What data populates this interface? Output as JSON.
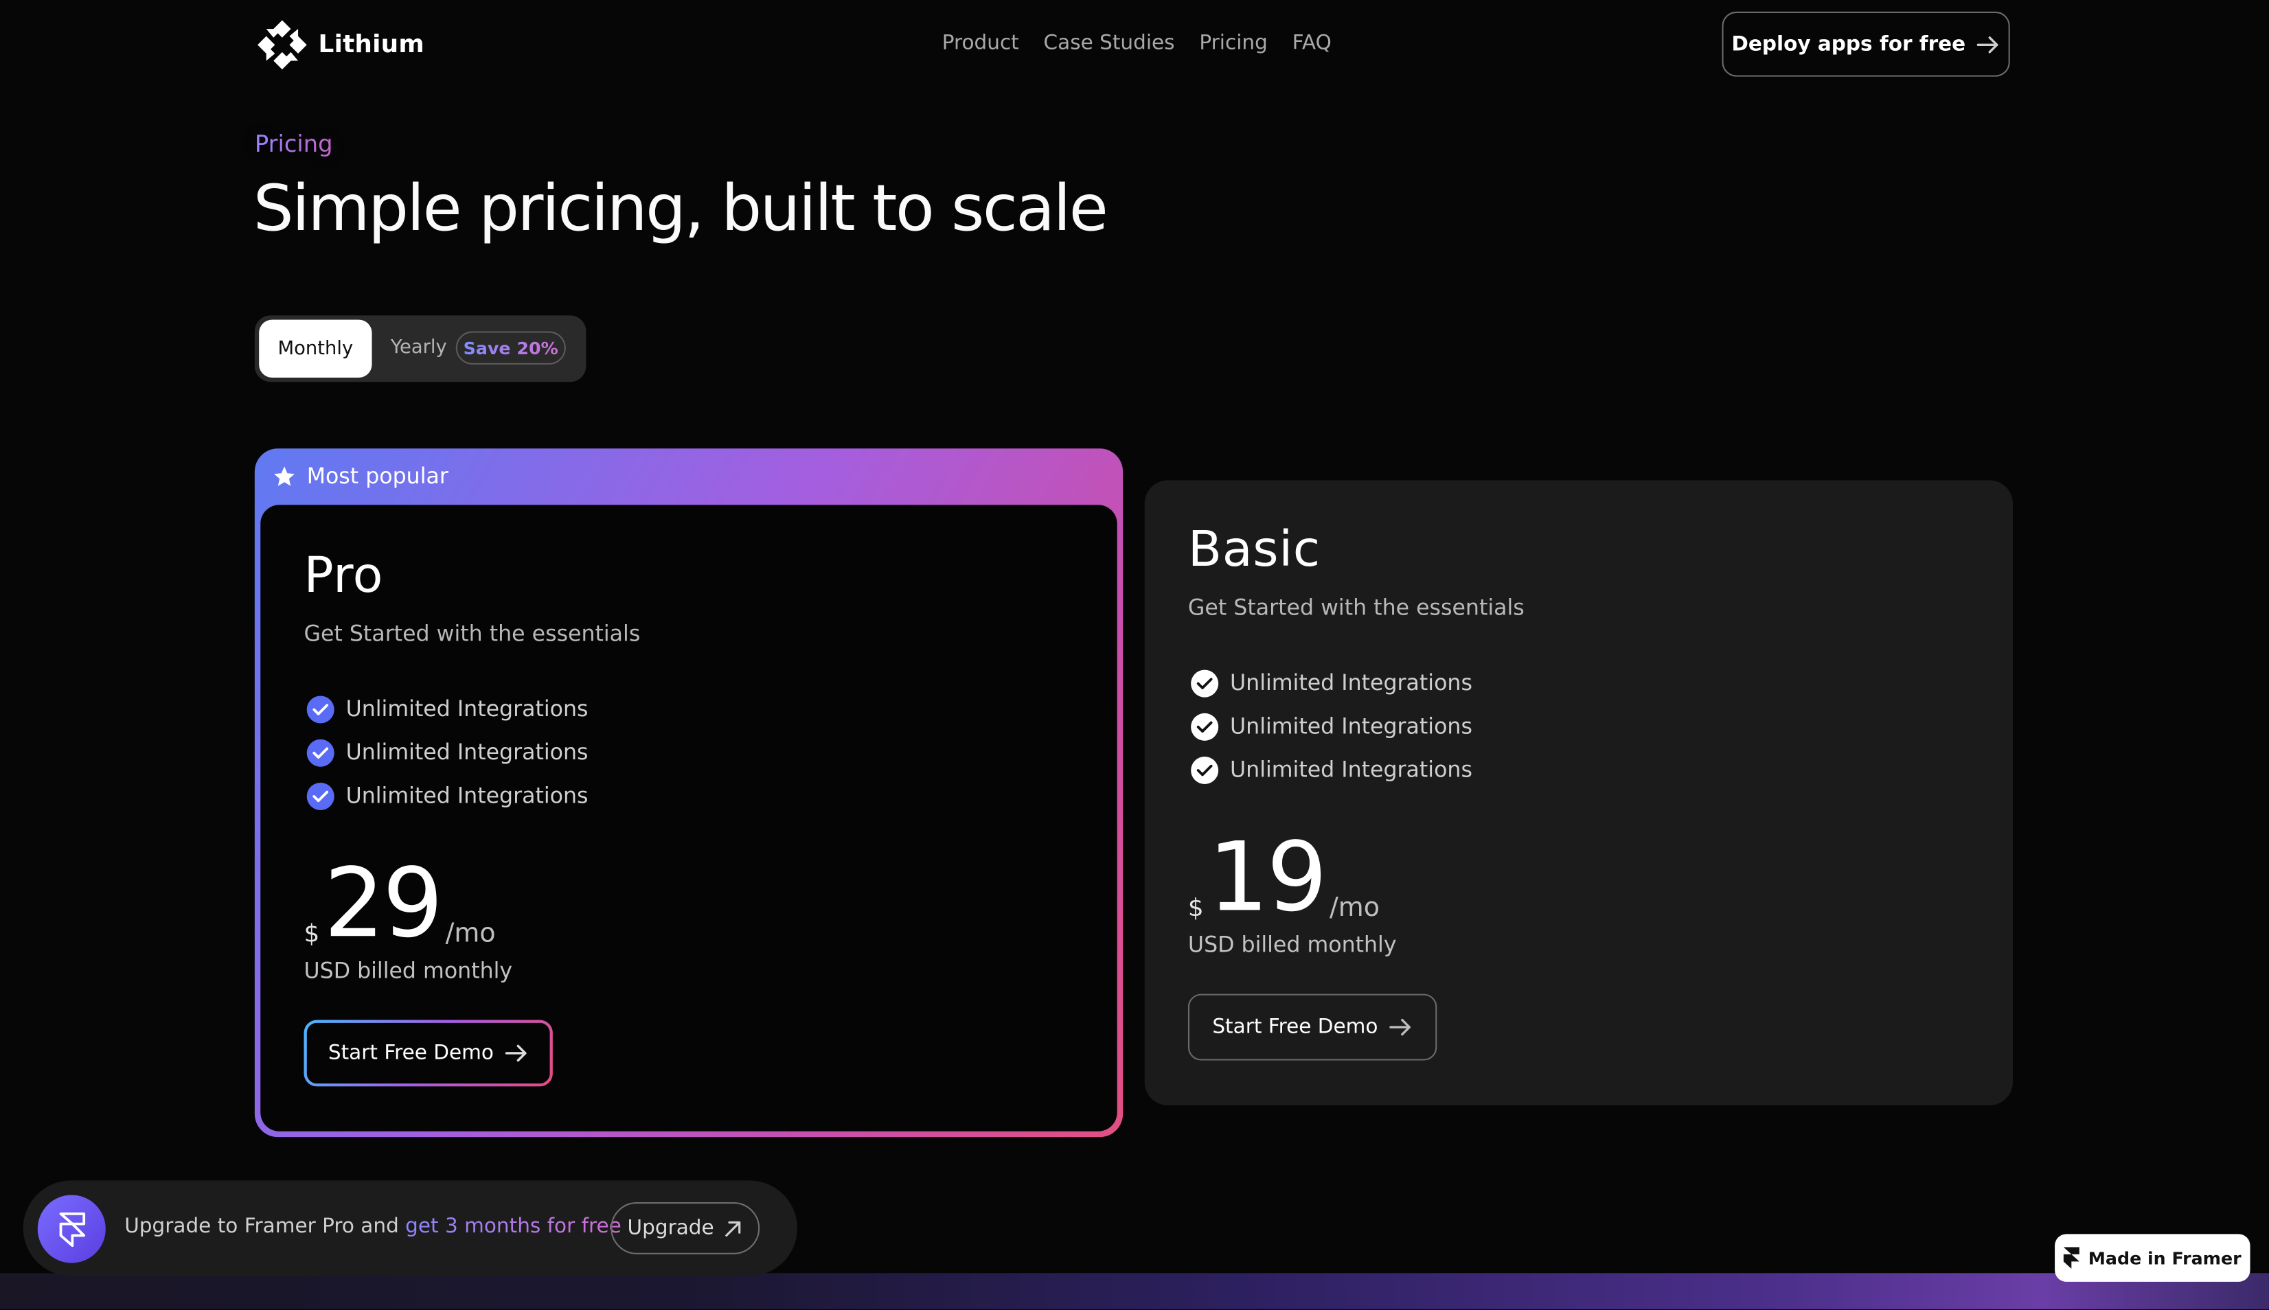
{
  "nav": {
    "brand": "Lithium",
    "links": [
      "Product",
      "Case Studies",
      "Pricing",
      "FAQ"
    ],
    "cta_label": "Deploy apps for free"
  },
  "hero": {
    "eyebrow": "Pricing",
    "title": "Simple pricing, built to scale"
  },
  "billing_toggle": {
    "monthly_label": "Monthly",
    "yearly_label": "Yearly",
    "save_badge": "Save 20%",
    "selected": "Monthly"
  },
  "plans": {
    "pro": {
      "badge": "Most popular",
      "name": "Pro",
      "subtitle": "Get Started with the essentials",
      "features": [
        "Unlimited Integrations",
        "Unlimited Integrations",
        "Unlimited Integrations"
      ],
      "currency": "$",
      "price": "29",
      "period": "/mo",
      "billing_note": "USD billed monthly",
      "cta_label": "Start Free Demo"
    },
    "basic": {
      "name": "Basic",
      "subtitle": "Get Started with the essentials",
      "features": [
        "Unlimited Integrations",
        "Unlimited Integrations",
        "Unlimited Integrations"
      ],
      "currency": "$",
      "price": "19",
      "period": "/mo",
      "billing_note": "USD billed monthly",
      "cta_label": "Start Free Demo"
    }
  },
  "framer_banner": {
    "text_prefix": "Upgrade to Framer Pro and ",
    "text_highlight": "get 3 months for free",
    "button_label": "Upgrade"
  },
  "made_in_framer": "Made in Framer",
  "colors": {
    "background": "#060606",
    "accent_gradient_start": "#5f7af2",
    "accent_gradient_end": "#e34f82",
    "check_pro": "#5a6cf5",
    "basic_card": "#1b1b1b"
  }
}
